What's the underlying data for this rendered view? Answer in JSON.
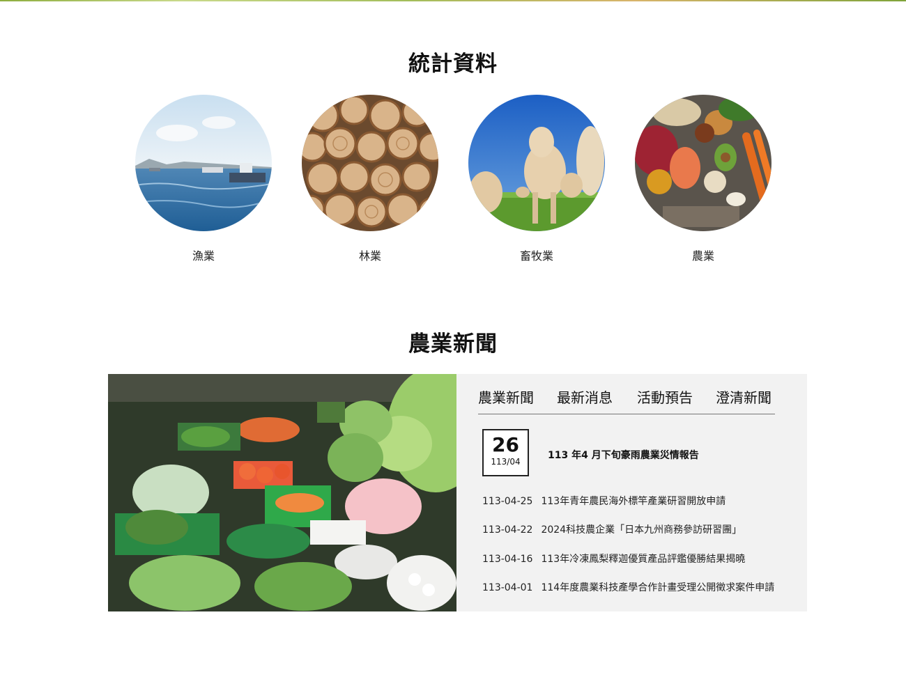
{
  "stats": {
    "title": "統計資料",
    "items": [
      {
        "label": "漁業"
      },
      {
        "label": "林業"
      },
      {
        "label": "畜牧業"
      },
      {
        "label": "農業"
      }
    ]
  },
  "news": {
    "title": "農業新聞",
    "tabs": [
      "農業新聞",
      "最新消息",
      "活動預告",
      "澄清新聞"
    ],
    "featured": {
      "day": "26",
      "year_month": "113/04",
      "title": "113 年4 月下旬豪雨農業災情報告"
    },
    "items": [
      {
        "date": "113-04-25",
        "title": "113年青年農民海外標竿產業研習開放申請"
      },
      {
        "date": "113-04-22",
        "title": "2024科技農企業「日本九州商務參訪研習團」"
      },
      {
        "date": "113-04-16",
        "title": "113年冷凍鳳梨釋迦優質產品評鑑優勝結果揭曉"
      },
      {
        "date": "113-04-01",
        "title": "114年度農業科技產學合作計畫受理公開徵求案件申請"
      }
    ]
  }
}
